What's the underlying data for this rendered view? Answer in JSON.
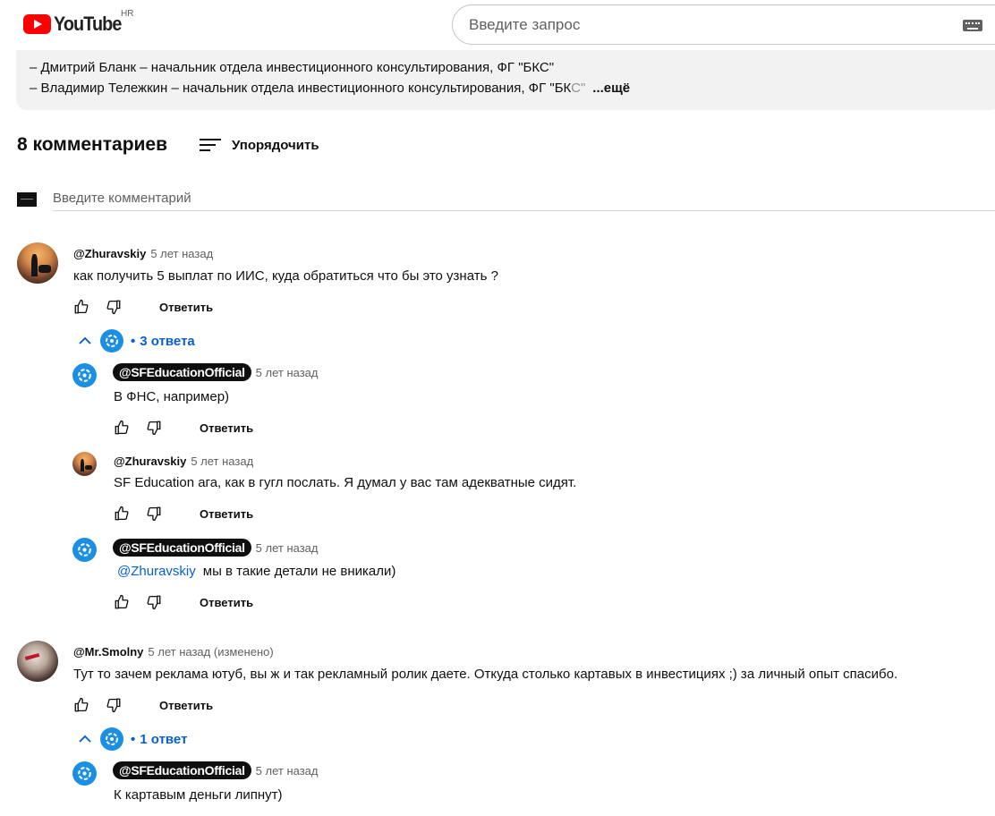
{
  "header": {
    "logo_text": "YouTube",
    "region": "HR",
    "search_placeholder": "Введите запрос"
  },
  "description": {
    "lines": [
      "– Дмитрий Бланк – начальник отдела инвестиционного консультирования, ФГ \"БКС\"",
      "– Владимир Тележкин – начальник отдела инвестиционного консультирования, ФГ \"БК"
    ],
    "fade_tail": "С\"",
    "more_label": "...ещё"
  },
  "comments_header": {
    "count_label": "8 комментариев",
    "sort_label": "Упорядочить"
  },
  "add_comment": {
    "placeholder": "Введите комментарий"
  },
  "reply_label": "Ответить",
  "comments": [
    {
      "author": "@Zhuravskiy",
      "time": "5 лет назад",
      "text": "как получить 5 выплат по ИИС, куда обратиться что бы это узнать ?",
      "replies_label": "3 ответа",
      "replies": [
        {
          "author": "@SFEducationOfficial",
          "time": "5 лет назад",
          "text": "В ФНС, например)"
        },
        {
          "author": "@Zhuravskiy",
          "time": "5 лет назад",
          "text": "SF Education ага, как в гугл послать. Я думал у вас там адекватные сидят."
        },
        {
          "author": "@SFEducationOfficial",
          "time": "5 лет назад",
          "mention": "@Zhuravskiy",
          "text": "мы в такие детали не вникали)"
        }
      ]
    },
    {
      "author": "@Mr.Smolny",
      "time": "5 лет назад (изменено)",
      "text": "Тут то зачем реклама ютуб, вы ж и так рекламный ролик даете. Откуда столько картавых в инвестициях ;) за личный опыт спасибо.",
      "replies_label": "1 ответ",
      "replies": [
        {
          "author": "@SFEducationOfficial",
          "time": "5 лет назад",
          "text": "К картавым деньги липнут)"
        }
      ]
    }
  ],
  "colors": {
    "link": "#065fd4",
    "brand_red": "#ff0000",
    "sf_blue": "#1a8fe3"
  }
}
